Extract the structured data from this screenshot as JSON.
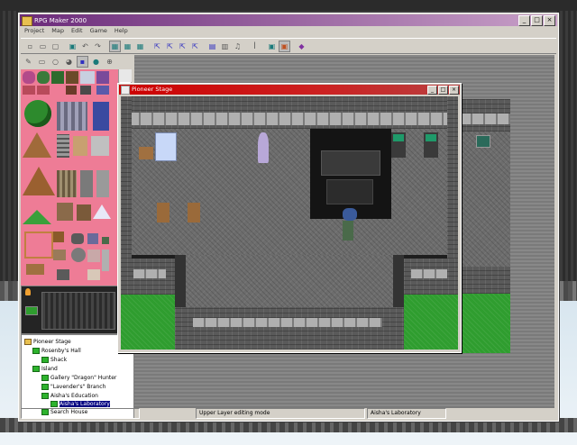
{
  "app": {
    "title": "RPG Maker 2000",
    "window_buttons": [
      "_",
      "□",
      "×"
    ]
  },
  "menu": [
    "Project",
    "Map",
    "Edit",
    "Game",
    "Help"
  ],
  "map_window": {
    "title": "Pioneer Stage",
    "buttons": [
      "_",
      "□",
      "×"
    ]
  },
  "map_tree": {
    "items": [
      {
        "label": "Pioneer Stage",
        "level": 0,
        "type": "root"
      },
      {
        "label": "Rosenby's Hall",
        "level": 1,
        "type": "map"
      },
      {
        "label": "Shack",
        "level": 2,
        "type": "map"
      },
      {
        "label": "Island",
        "level": 1,
        "type": "map"
      },
      {
        "label": "Gallery \"Dragon\" Hunter",
        "level": 2,
        "type": "map"
      },
      {
        "label": "\"Lavender's\" Branch",
        "level": 2,
        "type": "map"
      },
      {
        "label": "Aisha's Education",
        "level": 2,
        "type": "map"
      },
      {
        "label": "Aisha's Laboratory",
        "level": 3,
        "type": "map",
        "selected": true
      },
      {
        "label": "Search House",
        "level": 2,
        "type": "map"
      }
    ]
  },
  "status": {
    "mode": "Upper Layer editing mode",
    "map_name": "Aisha's Laboratory"
  }
}
